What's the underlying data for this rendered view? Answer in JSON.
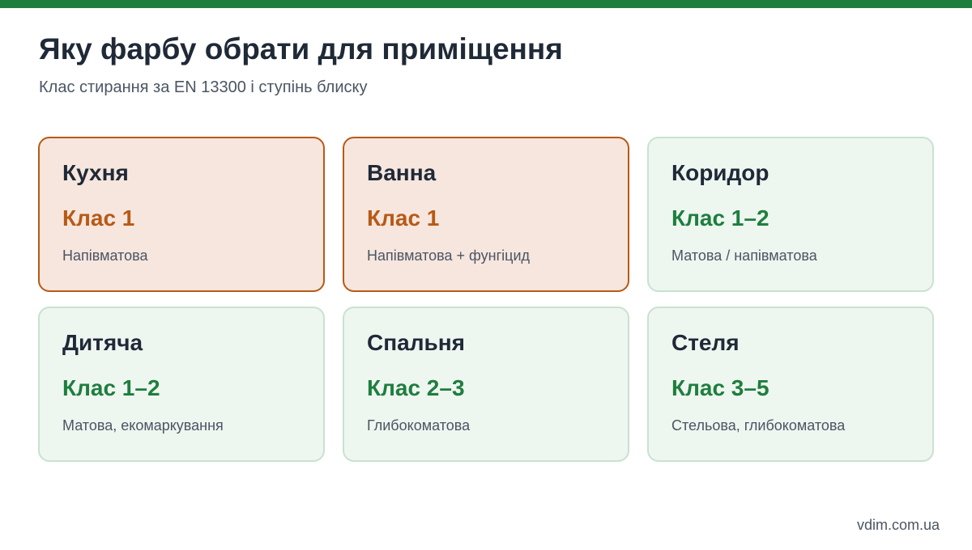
{
  "header": {
    "title": "Яку фарбу обрати для приміщення",
    "subtitle": "Клас стирання за EN 13300 і ступінь блиску"
  },
  "cards": [
    {
      "room": "Кухня",
      "class": "Клас 1",
      "note": "Напівматова",
      "highlight": true
    },
    {
      "room": "Ванна",
      "class": "Клас 1",
      "note": "Напівматова + фунгіцид",
      "highlight": true
    },
    {
      "room": "Коридор",
      "class": "Клас 1–2",
      "note": "Матова / напівматова",
      "highlight": false
    },
    {
      "room": "Дитяча",
      "class": "Клас 1–2",
      "note": "Матова, екомаркування",
      "highlight": false
    },
    {
      "room": "Спальня",
      "class": "Клас 2–3",
      "note": "Глибокоматова",
      "highlight": false
    },
    {
      "room": "Стеля",
      "class": "Клас 3–5",
      "note": "Стельова, глибокоматова",
      "highlight": false
    }
  ],
  "footer": {
    "site": "vdim.com.ua"
  },
  "colors": {
    "brand_green": "#1e7e3e",
    "accent_orange": "#b75a16",
    "accent_bg": "#f6e6de",
    "normal_bg": "#eef6f0"
  }
}
